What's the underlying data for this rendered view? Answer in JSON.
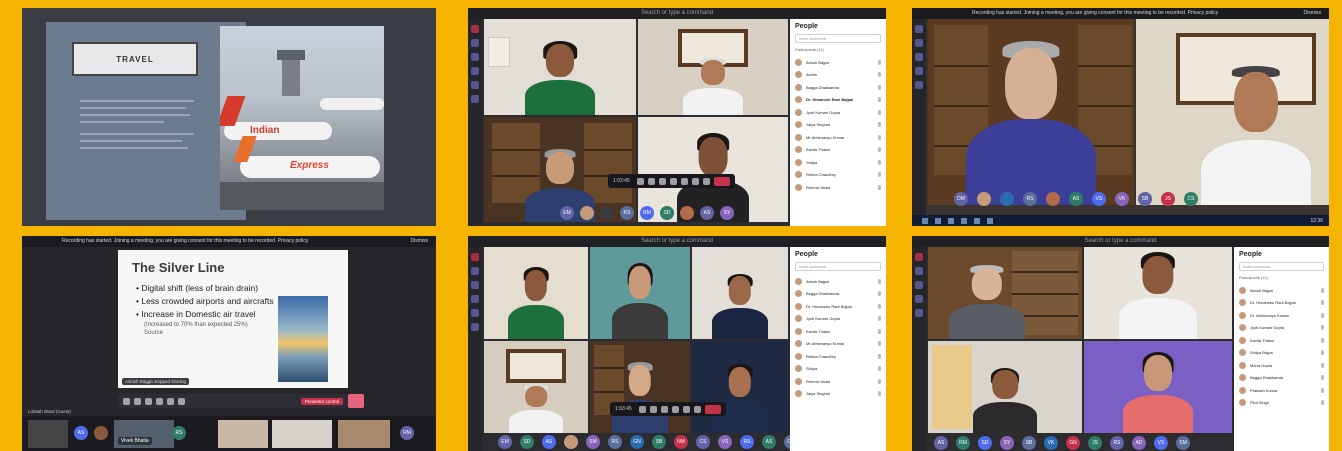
{
  "panels": {
    "travel": {
      "slide_title": "TRAVEL",
      "plane_label_1": "Indian",
      "plane_label_2": "Express"
    },
    "teams_top_middle": {
      "search_placeholder": "Search or type a command",
      "people_title": "People",
      "people_search": "Invite someone",
      "participants_label": "Participants (11)",
      "participants": [
        "Ashok Bajpai",
        "Ashim",
        "Bagga Dhakkanda",
        "Dr. Himanshi Rani Bajpai",
        "Jyoti Kumari Gupta",
        "Jaiya Singhal",
        "Mr Abhimanyu Kumar",
        "Kavita Thakur",
        "Shilpa",
        "Rekha Chaudhry",
        "Reema Vadra"
      ],
      "meeting_time": "1:03:45",
      "avatar_initials": [
        "EM",
        "RS",
        "RM",
        "SD",
        "AS",
        "SY"
      ]
    },
    "teams_top_right": {
      "banner": "Recording has started. Joining a meeting, you are giving consent for this meeting to be recorded. Privacy policy",
      "dismiss": "Dismiss",
      "avatar_initials": [
        "DM",
        "RS",
        "AS",
        "VS",
        "VK",
        "SB",
        "JS",
        "CS"
      ],
      "taskbar_time": "12:36"
    },
    "silver_line": {
      "banner": "Recording has started. Joining a meeting, you are giving consent for this meeting to be recorded. Privacy policy",
      "dismiss": "Dismiss",
      "slide_title": "The Silver Line",
      "bullets": [
        "Digital shift (less of brain drain)",
        "Less crowded airports and aircrafts",
        "Increase in Domestic air travel"
      ],
      "sub_bullet": "(Increased to 70% than expected 25%)",
      "source": "Source",
      "presenter_label": "Kiran Bajpai",
      "tooltip": "Ashish Bagga stopped sharing",
      "stop_label": "Presenter control",
      "footer_name": "Lohitah Ward (Guest)",
      "footer_guest": "Vivek Bhatia",
      "avatar_initials": [
        "AS",
        "RS",
        "RM"
      ]
    },
    "teams_bottom_middle": {
      "search_placeholder": "Search or type a command",
      "people_title": "People",
      "people_search": "Invite someone",
      "participants": [
        "Ashok Bajpai",
        "Bagga Dhakkanda",
        "Dr. Himanshu Rani Bajpai",
        "Jyoti Kumari Gupta",
        "Kavita Thakur",
        "Mr Abhimanyu Kumar",
        "Rekha Chaudhry",
        "Shilpa",
        "Reema Vadra",
        "Jaiya Singhal"
      ],
      "meeting_time": "1:03:45",
      "avatar_initials": [
        "EM",
        "SD",
        "AS",
        "SM",
        "RS",
        "GN",
        "SB",
        "NM",
        "CS",
        "VS",
        "RS",
        "AS",
        "GN"
      ]
    },
    "teams_bottom_right": {
      "search_placeholder": "Search or type a command",
      "people_title": "People",
      "people_search": "Invite someone",
      "participants_label": "Participants (11)",
      "participants": [
        "Ashok Bajpai",
        "Dr. Himanshu Rani Bajpai",
        "Dr. Abhimanyu Kumar",
        "Jyoti Kumari Gupta",
        "Kavita Thakur",
        "Shilpa Bajpai",
        "Mona Gupta",
        "Bagga Dhakkanda",
        "Prakash Kumar",
        "Pilot Singh"
      ],
      "avatar_initials": [
        "AS",
        "RM",
        "SD",
        "SY",
        "SB",
        "VK",
        "GN",
        "JS",
        "RS",
        "AD",
        "VS",
        "SM"
      ]
    }
  },
  "colors": {
    "background": "#f4b400",
    "teams_purple": "#6264a7",
    "leave_red": "#c4314b"
  }
}
